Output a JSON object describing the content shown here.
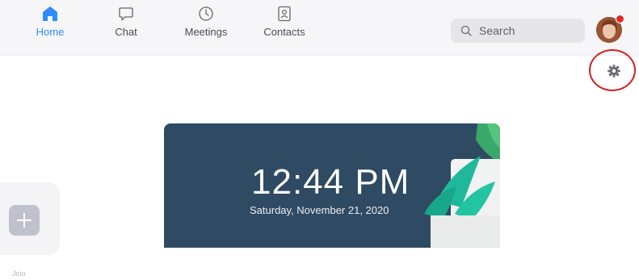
{
  "nav": {
    "tabs": [
      {
        "label": "Home",
        "icon": "home-icon",
        "active": true
      },
      {
        "label": "Chat",
        "icon": "chat-icon",
        "active": false
      },
      {
        "label": "Meetings",
        "icon": "clock-icon",
        "active": false
      },
      {
        "label": "Contacts",
        "icon": "contacts-icon",
        "active": false
      }
    ]
  },
  "search": {
    "placeholder": "Search"
  },
  "clock": {
    "time": "12:44 PM",
    "date": "Saturday, November 21, 2020"
  },
  "sidebar": {
    "add_label": "Join"
  },
  "colors": {
    "accent": "#2d8cff",
    "card_bg": "#2f4a63",
    "highlight_ring": "#d62020",
    "notification": "#e02828",
    "plant": "#1fb89a"
  }
}
